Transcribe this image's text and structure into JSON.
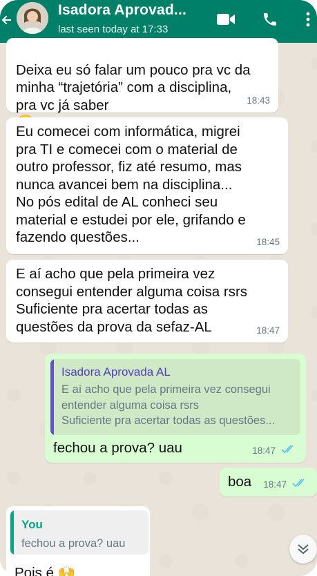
{
  "header": {
    "contact_name": "Isadora Aprovad...",
    "status": "last seen today at 17:33",
    "icons": [
      "back-arrow-icon",
      "video-call-icon",
      "phone-icon",
      "more-options-icon"
    ],
    "color": "#008069"
  },
  "messages": [
    {
      "direction": "in",
      "text": "Deixa eu só falar um pouco pra vc da\nminha “trajetória” com a disciplina,\npra vc já saber",
      "emoji": "😊",
      "time": "18:43"
    },
    {
      "direction": "in",
      "text": "Eu comecei com informática, migrei\npra TI e comecei com o material de\noutro professor, fiz até resumo, mas\nnunca avancei bem na disciplina...\nNo pós edital de AL conheci seu\nmaterial e estudei por ele, grifando e\nfazendo questões...",
      "time": "18:45"
    },
    {
      "direction": "in",
      "text": "E aí acho que pela primeira vez\nconsegui entender alguma coisa rsrs\nSuficiente pra acertar todas as\nquestões da prova da sefaz-AL",
      "time": "18:47"
    },
    {
      "direction": "out",
      "quote_name": "Isadora Aprovada AL",
      "quote_text": "E aí acho que pela primeira vez consegui\nentender alguma coisa rsrs\nSuficiente pra acertar todas as questões...",
      "text": "fechou a prova? uau",
      "time": "18:47",
      "read": true
    },
    {
      "direction": "out",
      "text": "boa",
      "time": "18:47",
      "read": true
    },
    {
      "direction": "in",
      "quote_name": "You",
      "quote_text": "fechou a prova? uau",
      "text": "Pois é",
      "emoji": "🙌"
    }
  ],
  "colors": {
    "incoming": "#ffffff",
    "outgoing": "#d9fdd3",
    "read_ticks": "#53bdeb"
  }
}
